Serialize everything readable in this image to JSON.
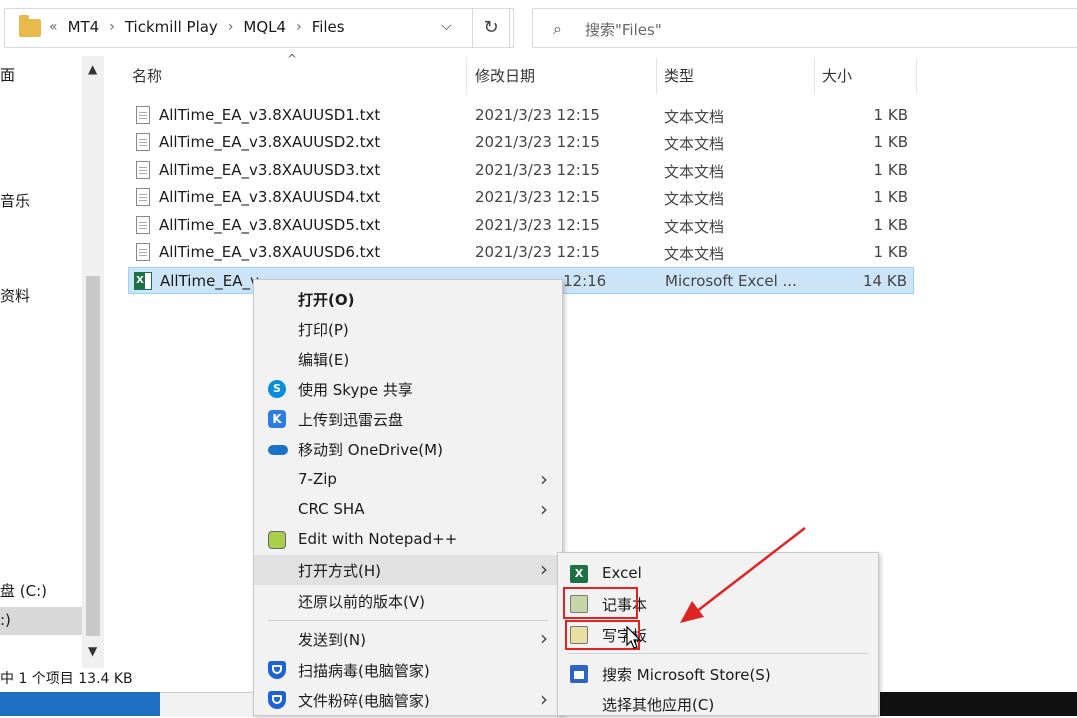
{
  "address_bar": {
    "overflow": "«",
    "crumbs": [
      "MT4",
      "Tickmill Play",
      "MQL4",
      "Files"
    ],
    "dropdown_glyph": "⌵",
    "refresh_glyph": "↻"
  },
  "search": {
    "placeholder": "搜索\"Files\"",
    "icon": "search-icon"
  },
  "nav_pane": {
    "items": [
      "乐",
      "音乐",
      "资料",
      "盘 (C:)",
      ":)"
    ],
    "partial_items": [
      "面"
    ]
  },
  "columns": {
    "name": "名称",
    "date": "修改日期",
    "type": "类型",
    "size": "大小"
  },
  "files": [
    {
      "name": "AllTime_EA_v3.8XAUUSD1.txt",
      "date": "2021/3/23 12:15",
      "type": "文本文档",
      "size": "1 KB"
    },
    {
      "name": "AllTime_EA_v3.8XAUUSD2.txt",
      "date": "2021/3/23 12:15",
      "type": "文本文档",
      "size": "1 KB"
    },
    {
      "name": "AllTime_EA_v3.8XAUUSD3.txt",
      "date": "2021/3/23 12:15",
      "type": "文本文档",
      "size": "1 KB"
    },
    {
      "name": "AllTime_EA_v3.8XAUUSD4.txt",
      "date": "2021/3/23 12:15",
      "type": "文本文档",
      "size": "1 KB"
    },
    {
      "name": "AllTime_EA_v3.8XAUUSD5.txt",
      "date": "2021/3/23 12:15",
      "type": "文本文档",
      "size": "1 KB"
    },
    {
      "name": "AllTime_EA_v3.8XAUUSD6.txt",
      "date": "2021/3/23 12:15",
      "type": "文本文档",
      "size": "1 KB"
    },
    {
      "name": "AllTime_EA_v",
      "date": "12:16",
      "type": "Microsoft Excel ...",
      "size": "14 KB",
      "selected": true
    }
  ],
  "status_bar": {
    "text": "中 1 个项目  13.4 KB"
  },
  "context_menu": {
    "items": [
      {
        "label": "打开(O)"
      },
      {
        "label": "打印(P)"
      },
      {
        "label": "编辑(E)"
      },
      {
        "label": "使用 Skype 共享",
        "icon": "skype-icon"
      },
      {
        "label": "上传到迅雷云盘",
        "icon": "xunlei-icon"
      },
      {
        "label": "移动到 OneDrive(M)",
        "icon": "onedrive-icon"
      },
      {
        "label": "7-Zip",
        "submenu": true
      },
      {
        "label": "CRC SHA",
        "submenu": true
      },
      {
        "label": "Edit with Notepad++",
        "icon": "notepadpp-icon"
      },
      {
        "label": "打开方式(H)",
        "submenu": true,
        "highlighted": true
      },
      {
        "label": "还原以前的版本(V)"
      },
      {
        "label": "发送到(N)",
        "submenu": true
      },
      {
        "label": "扫描病毒(电脑管家)",
        "icon": "shield-icon"
      },
      {
        "label": "文件粉碎(电脑管家)",
        "icon": "shield-icon",
        "submenu": true
      }
    ],
    "arrow_glyph": "›"
  },
  "open_with_submenu": {
    "items": [
      {
        "label": "Excel",
        "icon": "excel-icon"
      },
      {
        "label": "记事本",
        "icon": "notepad-icon"
      },
      {
        "label": "写字板",
        "icon": "wordpad-icon"
      },
      {
        "label": "搜索 Microsoft Store(S)",
        "icon": "store-icon"
      },
      {
        "label": "选择其他应用(C)"
      }
    ]
  },
  "colors": {
    "selection": "#cce4f7",
    "annotation_red": "#e02424",
    "highlight_glow": "#ffe650"
  }
}
